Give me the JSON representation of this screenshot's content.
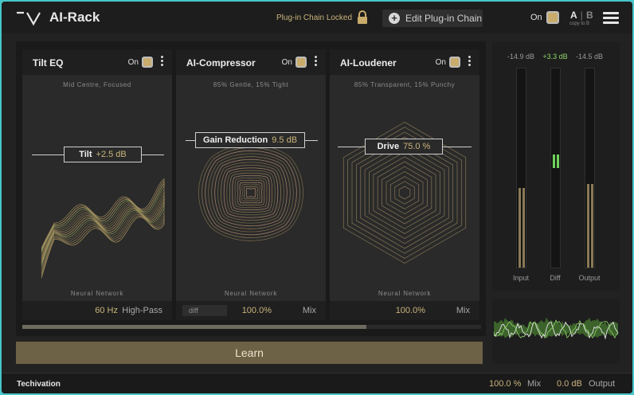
{
  "app": {
    "title": "AI-Rack"
  },
  "header": {
    "lock_text": "Plug-in Chain Locked",
    "edit_label": "Edit Plug-in Chain",
    "on_label": "On",
    "ab_a": "A",
    "ab_sep": "|",
    "ab_b": "B",
    "copy_to_b": "copy to B"
  },
  "modules": [
    {
      "title": "Tilt EQ",
      "on_label": "On",
      "subtitle": "Mid Centre, Focused",
      "param_label": "Tilt",
      "param_value": "+2.5 dB",
      "footer": "Neural Network",
      "bottom_value": "60 Hz",
      "bottom_label": "High-Pass"
    },
    {
      "title": "AI-Compressor",
      "on_label": "On",
      "subtitle": "85% Gentle, 15% Tight",
      "param_label": "Gain Reduction",
      "param_value": "9.5 dB",
      "footer": "Neural Network",
      "diff_label": "diff",
      "bottom_value": "100.0%",
      "bottom_label": "Mix"
    },
    {
      "title": "AI-Loudener",
      "on_label": "On",
      "subtitle": "85% Transparent, 15% Punchy",
      "param_label": "Drive",
      "param_value": "75.0 %",
      "footer": "Neural Network",
      "bottom_value": "100.0%",
      "bottom_label": "Mix"
    }
  ],
  "learn_label": "Learn",
  "meters": {
    "input_value": "-14.9 dB",
    "diff_value": "+3.3 dB",
    "output_value": "-14.5 dB",
    "input_label": "Input",
    "diff_label": "Diff",
    "output_label": "Output",
    "input_level": 0.4,
    "output_level": 0.42,
    "diff_level": 0.07
  },
  "scroll": {
    "position": 0.75
  },
  "footer": {
    "brand": "Techivation",
    "mix_value": "100.0 %",
    "mix_label": "Mix",
    "output_value": "0.0 dB",
    "output_label": "Output"
  },
  "colors": {
    "accent_gold": "#c9b37b",
    "toggle_fill": "#c9ab6c",
    "learn_bar": "#6d6146",
    "meter_green": "#6ed35a"
  }
}
